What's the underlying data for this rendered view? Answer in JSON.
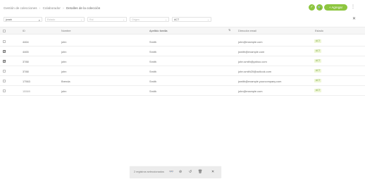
{
  "breadcrumb": [
    "Gestión de colecciones",
    "Colaborador",
    "Detalles de la colección"
  ],
  "toolbar": {
    "check_icon": "✓",
    "search_icon": "🔍",
    "add_label": "+ Agregar",
    "more_icon": "⋮"
  },
  "filters": {
    "search_value": "jonah",
    "select1_placeholder": "Estado",
    "select2_placeholder": "Rol",
    "select3_placeholder": "Origen",
    "select4_value": "ACT",
    "clear_icon": "✕"
  },
  "table": {
    "columns": [
      "ID",
      "Nombre",
      "Apellido familia",
      "Dirección email",
      "Estado"
    ],
    "rows": [
      {
        "checked": false,
        "id": "4464",
        "name": "john",
        "surname": "Smith",
        "email": "john@example.com",
        "status": "ACT"
      },
      {
        "checked": true,
        "id": "4465",
        "name": "john",
        "surname": "Smith",
        "email": "jsmith@example.com",
        "status": "ACT"
      },
      {
        "checked": true,
        "id": "3788",
        "name": "john",
        "surname": "Smith",
        "email": "john.smith@yahoo.com",
        "status": "ACT"
      },
      {
        "checked": false,
        "id": "3788",
        "name": "john",
        "surname": "Smith",
        "email": "john.smith20@outlook.com",
        "status": "ACT"
      },
      {
        "checked": false,
        "id": "17563",
        "name": "Brenda",
        "surname": "Smith",
        "email": "jsmith@example.yourcompany.com",
        "status": "ACT"
      },
      {
        "checked": false,
        "id": "15569",
        "name": "john",
        "surname": "Smith",
        "email": "john@example.com",
        "status": "ACT"
      }
    ]
  },
  "bulk_actions": {
    "selected_text": "2 registros seleccionados",
    "icons": [
      "👓",
      "⊘",
      "↺",
      "🗑",
      "✕"
    ]
  }
}
